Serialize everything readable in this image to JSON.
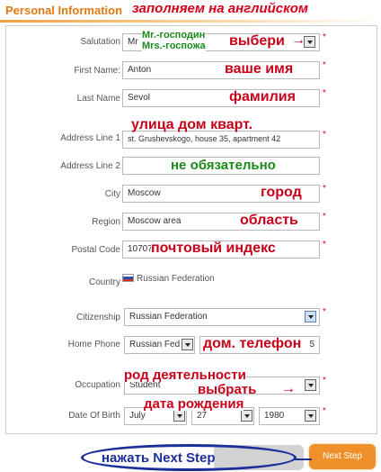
{
  "header": {
    "title": "Personal Information",
    "annotation": "заполняем на английском"
  },
  "form": {
    "salutation": {
      "label": "Salutation",
      "value": "Mr",
      "anno_green_1": "Mr.-господин",
      "anno_green_2": "Mrs.-госпожа",
      "anno_red": "выбери",
      "arrow": "→"
    },
    "first_name": {
      "label": "First Name:",
      "value": "Anton",
      "anno": "ваше имя"
    },
    "last_name": {
      "label": "Last Name",
      "value": "Sevol",
      "anno": "фамилия"
    },
    "address1": {
      "label": "Address Line 1",
      "value": "st. Grushevskogo, house 35, apartment 42",
      "anno": "улица  дом кварт."
    },
    "address2": {
      "label": "Address Line 2",
      "value": "",
      "anno": "не обязательно"
    },
    "city": {
      "label": "City",
      "value": "Moscow",
      "anno": "город"
    },
    "region": {
      "label": "Region",
      "value": "Moscow area",
      "anno": "область"
    },
    "postal_code": {
      "label": "Postal Code",
      "value": "10707",
      "anno": "почтовый индекс"
    },
    "country": {
      "label": "Country",
      "value": "Russian Federation"
    },
    "citizenship": {
      "label": "Citizenship",
      "value": "Russian Federation"
    },
    "home_phone": {
      "label": "Home Phone",
      "country_value": "Russian Fed",
      "number_suffix": "5",
      "anno": "дом. телефон"
    },
    "occupation": {
      "label": "Occupation",
      "value": "Student",
      "anno_1": "род деятельности",
      "anno_2": "выбрать",
      "arrow": "→"
    },
    "dob": {
      "label": "Date Of Birth",
      "month": "July",
      "day": "27",
      "year": "1980",
      "anno": "дата рождения"
    },
    "required_mark": "*"
  },
  "buttons": {
    "next_label": "Next Step",
    "next_annotation": "нажать Next Step"
  },
  "colors": {
    "accent": "#e07a10",
    "annotation_red": "#c8001a",
    "annotation_green": "#1a8a1a",
    "annotation_blue": "#1a2f9a",
    "button_orange": "#f0902a"
  }
}
